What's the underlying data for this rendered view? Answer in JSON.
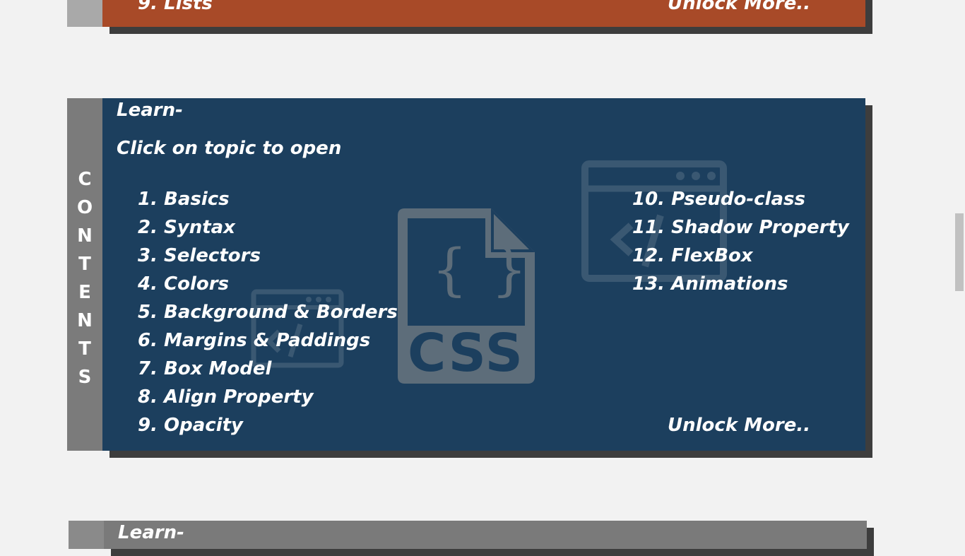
{
  "top_card": {
    "last_topic": "9. Lists",
    "unlock": "Unlock More.."
  },
  "main_card": {
    "tab_label": [
      "C",
      "O",
      "N",
      "T",
      "E",
      "N",
      "T",
      "S"
    ],
    "heading": "Learn-",
    "instruction": "Click on topic to open",
    "topics_left": [
      "1. Basics",
      "2. Syntax",
      "3. Selectors",
      "4. Colors",
      "5. Background & Borders",
      "6. Margins & Paddings",
      "7. Box Model",
      "8. Align Property",
      "9. Opacity"
    ],
    "topics_right": [
      "10. Pseudo-class",
      "11. Shadow Property",
      "12. FlexBox",
      "13. Animations"
    ],
    "unlock": "Unlock More..",
    "watermark_text": "CSS",
    "watermark_braces": "{ }",
    "watermark_icons": [
      "css-file-icon",
      "browser-code-icon"
    ]
  },
  "bottom_card": {
    "heading": "Learn-"
  },
  "colors": {
    "top_card": "#a84a28",
    "main_card": "#1c3f5e",
    "bottom_card": "#7a7a7a",
    "tab": "#7b7b7b",
    "shadow": "#3d3d3d",
    "background": "#f2f2f2"
  }
}
